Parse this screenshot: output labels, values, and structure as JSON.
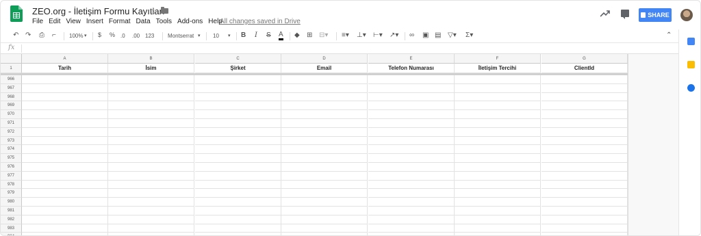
{
  "doc": {
    "title": "ZEO.org - İletişim Formu Kayıtları",
    "saved_status": "All changes saved in Drive"
  },
  "menu": [
    "File",
    "Edit",
    "View",
    "Insert",
    "Format",
    "Data",
    "Tools",
    "Add-ons",
    "Help"
  ],
  "share_label": "SHARE",
  "toolbar": {
    "zoom": "100%",
    "currency": "$",
    "percent": "%",
    "dec_less": ".0",
    "dec_more": ".00",
    "more_formats": "123",
    "font": "Montserrat",
    "font_size": "10",
    "bold": "B",
    "italic": "I",
    "strike": "S",
    "text_color": "A",
    "functions": "Σ"
  },
  "formula_label": "fx",
  "columns": [
    "A",
    "B",
    "C",
    "D",
    "E",
    "F",
    "G"
  ],
  "header_row_number": "1",
  "headers": [
    "Tarih",
    "İsim",
    "Şirket",
    "Email",
    "Telefon Numarası",
    "İletişim Tercihi",
    "ClientId"
  ],
  "row_numbers": [
    "966",
    "967",
    "968",
    "969",
    "970",
    "971",
    "972",
    "973",
    "974",
    "975",
    "976",
    "977",
    "978",
    "979",
    "980",
    "981",
    "982",
    "983",
    "984"
  ],
  "colors": {
    "accent": "#4285f4",
    "sheets_green": "#0f9d58"
  }
}
